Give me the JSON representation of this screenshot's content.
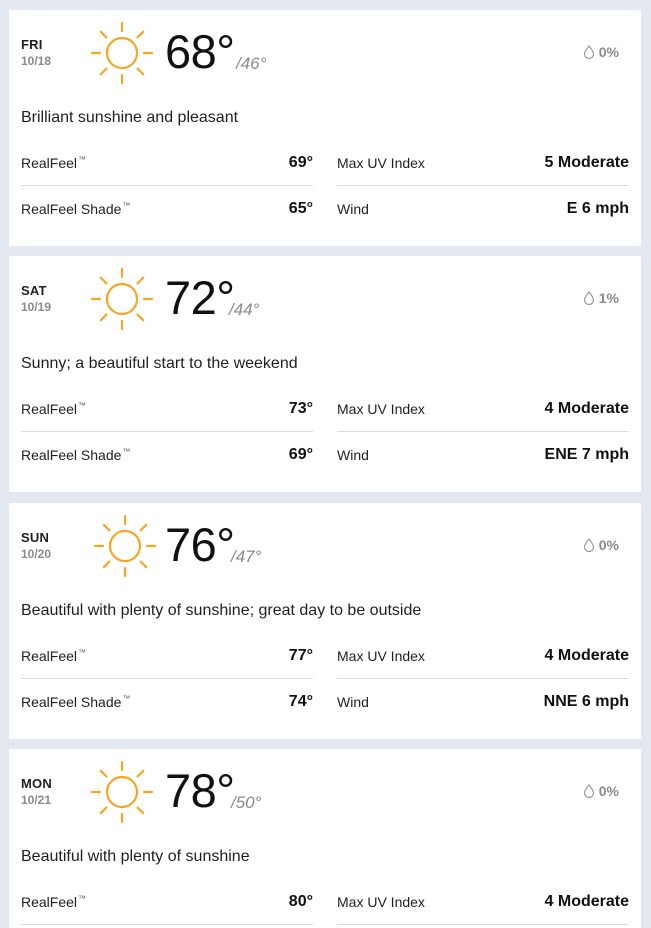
{
  "labels": {
    "realfeel": "RealFeel",
    "realfeel_shade": "RealFeel Shade",
    "trademark": "™",
    "max_uv": "Max UV Index",
    "wind": "Wind"
  },
  "days": [
    {
      "dow": "FRI",
      "date": "10/18",
      "hi": "68°",
      "lo": "/46°",
      "precip": "0%",
      "phrase": "Brilliant sunshine and pleasant",
      "realfeel": "69°",
      "realfeel_shade": "65°",
      "uv": "5 Moderate",
      "wind": "E 6 mph",
      "icon": "sun-icon"
    },
    {
      "dow": "SAT",
      "date": "10/19",
      "hi": "72°",
      "lo": "/44°",
      "precip": "1%",
      "phrase": "Sunny; a beautiful start to the weekend",
      "realfeel": "73°",
      "realfeel_shade": "69°",
      "uv": "4 Moderate",
      "wind": "ENE 7 mph",
      "icon": "sun-icon"
    },
    {
      "dow": "SUN",
      "date": "10/20",
      "hi": "76°",
      "lo": "/47°",
      "precip": "0%",
      "phrase": "Beautiful with plenty of sunshine; great day to be outside",
      "realfeel": "77°",
      "realfeel_shade": "74°",
      "uv": "4 Moderate",
      "wind": "NNE 6 mph",
      "icon": "sun-icon"
    },
    {
      "dow": "MON",
      "date": "10/21",
      "hi": "78°",
      "lo": "/50°",
      "precip": "0%",
      "phrase": "Beautiful with plenty of sunshine",
      "realfeel": "80°",
      "uv": "4 Moderate",
      "icon": "sun-icon"
    }
  ],
  "colors": {
    "sun": "#f5a623",
    "background": "#e4e9f1",
    "card": "#ffffff",
    "muted": "#8a8a8a"
  }
}
